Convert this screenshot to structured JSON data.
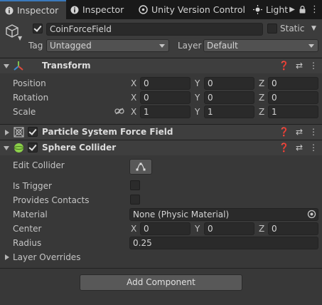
{
  "tabs": [
    {
      "label": "Inspector",
      "icon": "info-icon",
      "active": true
    },
    {
      "label": "Inspector",
      "icon": "info-icon",
      "active": false
    },
    {
      "label": "Unity Version Control",
      "icon": "version-control-icon",
      "active": false
    },
    {
      "label": "Light",
      "icon": "light-icon",
      "active": false
    }
  ],
  "header": {
    "object_name": "CoinForceField",
    "static_label": "Static",
    "tag_label": "Tag",
    "tag_value": "Untagged",
    "layer_label": "Layer",
    "layer_value": "Default"
  },
  "transform": {
    "title": "Transform",
    "rows": [
      {
        "label": "Position",
        "x": "0",
        "y": "0",
        "z": "0"
      },
      {
        "label": "Rotation",
        "x": "0",
        "y": "0",
        "z": "0"
      },
      {
        "label": "Scale",
        "x": "1",
        "y": "1",
        "z": "1"
      }
    ]
  },
  "axes": {
    "x": "X",
    "y": "Y",
    "z": "Z"
  },
  "particle_force_field": {
    "title": "Particle System Force Field"
  },
  "sphere_collider": {
    "title": "Sphere Collider",
    "edit_collider_label": "Edit Collider",
    "is_trigger_label": "Is Trigger",
    "provides_contacts_label": "Provides Contacts",
    "material_label": "Material",
    "material_value": "None (Physic Material)",
    "center_label": "Center",
    "center": {
      "x": "0",
      "y": "0",
      "z": "0"
    },
    "radius_label": "Radius",
    "radius_value": "0.25",
    "layer_overrides_label": "Layer Overrides"
  },
  "add_component_label": "Add Component",
  "colors": {
    "accent": "#3a79bb",
    "background": "#383838",
    "field": "#2a2a2a"
  }
}
